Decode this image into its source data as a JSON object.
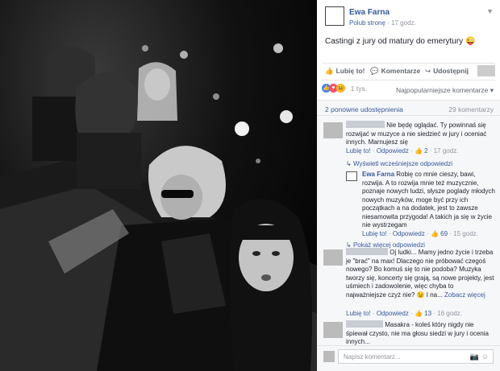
{
  "photo": {
    "alt_icon": "group-selfie-photo"
  },
  "post": {
    "page_name": "Ewa Farna",
    "follow_label": "Polub stronę",
    "separator": "·",
    "time": "17 godz.",
    "text": "Castingi z jury od matury do emerytury 😜"
  },
  "actions": {
    "like": "Lubię to!",
    "comment": "Komentarze",
    "share": "Udostępnij"
  },
  "reactions": {
    "count": "1 tys.",
    "sort": "Najpopularniejsze komentarze ▾"
  },
  "stats": {
    "shares": "2 ponowne udostępnienia",
    "comments": "29 komentarzy"
  },
  "comments": [
    {
      "text": "Nie będę oglądać. Ty powinnaś się rozwijać w muzyce a nie siedzieć w jury i oceniać innych. Marnujesz się",
      "like": "Lubię to!",
      "reply": "Odpowiedz",
      "likes": "2",
      "time": "17 godz.",
      "more_replies": "Wyświetl wcześniejsze odpowiedzi"
    },
    {
      "author": "Ewa Farna",
      "text": "Robię co mnie cieszy, bawi, rozwija. A to rozwija mnie też muzycznie, poznaje nowych ludzi, słysze poglady młodych nowych muzyków, moge być przy ich początkach a na dodatek, jest to zawsze niesamowita przygoda! A takich ja się w życie nie wystrzegam",
      "like": "Lubię to!",
      "reply": "Odpowiedz",
      "likes": "69",
      "time": "15 godz.",
      "more_replies": "Pokaż więcej odpowiedzi"
    },
    {
      "text": "Oj ludki... Mamy jedno życie i trzeba je \"brać\" na max! Dlaczego nie próbować czegoś nowego? Bo komuś się to nie podoba? Muzyka tworzy się, koncerty się grają, są nowe projekty, jest uśmiech i zadowolenie, więc chyba to najważniejsze czyż nie? 😉 I na...",
      "see_more": "Zobacz więcej",
      "like": "Lubię to!",
      "reply": "Odpowiedz",
      "likes": "13",
      "time": "16 godz."
    },
    {
      "text": "Masakra - koleś który nigdy nie śpiewał czysto, nie ma głosu siedzi w jury i ocenia innych..."
    }
  ],
  "input": {
    "placeholder": "Napisz komentarz..."
  },
  "icons": {
    "camera": "camera-icon",
    "emoji": "emoji-icon"
  },
  "colors": {
    "link": "#365899",
    "muted": "#90949c",
    "feed_bg": "#f6f7f9"
  }
}
